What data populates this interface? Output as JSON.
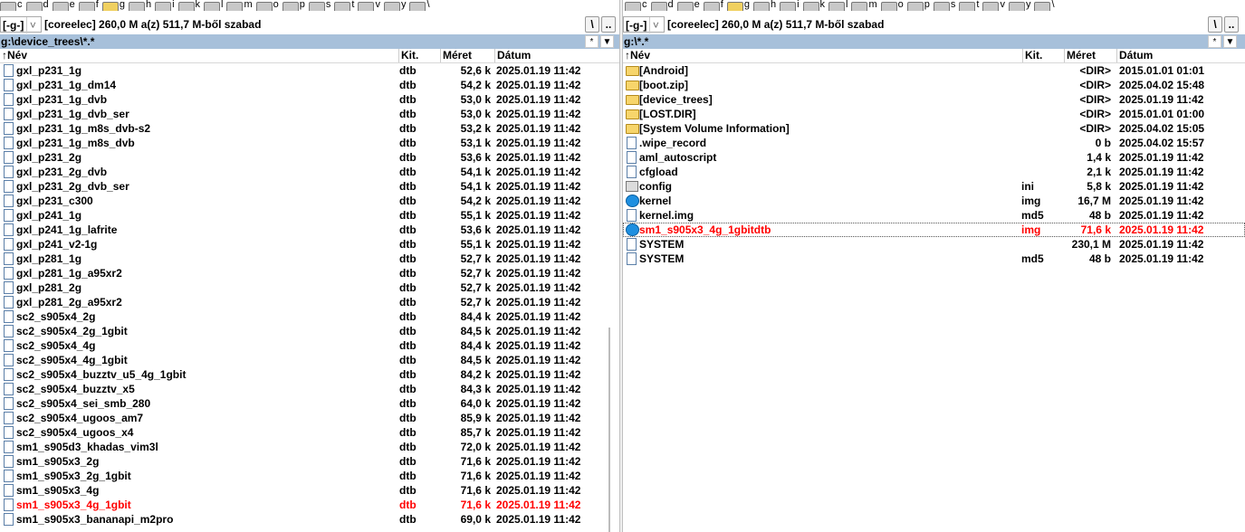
{
  "drives_left": [
    {
      "letter": "c"
    },
    {
      "letter": "d"
    },
    {
      "letter": "e"
    },
    {
      "letter": "f"
    },
    {
      "letter": "g",
      "active": true
    },
    {
      "letter": "h"
    },
    {
      "letter": "i"
    },
    {
      "letter": "k"
    },
    {
      "letter": "l"
    },
    {
      "letter": "m"
    },
    {
      "letter": "o"
    },
    {
      "letter": "p"
    },
    {
      "letter": "s"
    },
    {
      "letter": "t"
    },
    {
      "letter": "v"
    },
    {
      "letter": "y"
    },
    {
      "letter": "\\"
    }
  ],
  "drives_right": [
    {
      "letter": "c"
    },
    {
      "letter": "d"
    },
    {
      "letter": "e"
    },
    {
      "letter": "f"
    },
    {
      "letter": "g",
      "active": true
    },
    {
      "letter": "h"
    },
    {
      "letter": "i"
    },
    {
      "letter": "k"
    },
    {
      "letter": "l"
    },
    {
      "letter": "m"
    },
    {
      "letter": "o"
    },
    {
      "letter": "p"
    },
    {
      "letter": "s"
    },
    {
      "letter": "t"
    },
    {
      "letter": "v"
    },
    {
      "letter": "y"
    },
    {
      "letter": "\\"
    }
  ],
  "left": {
    "drive_combo": "[-g-]",
    "space_info": "[coreelec]  260,0 M a(z) 511,7 M-ből szabad",
    "btn_root": "\\",
    "btn_up": "..",
    "path": "g:\\device_trees\\*.*",
    "filter_btn": "*",
    "history_btn": "▼",
    "headers": {
      "name": "↑Név",
      "ext": "Kit.",
      "size": "Méret",
      "date": "Dátum"
    },
    "files": [
      {
        "name": "gxl_p231_1g",
        "ext": "dtb",
        "size": "52,6 k",
        "date": "2025.01.19 11:42"
      },
      {
        "name": "gxl_p231_1g_dm14",
        "ext": "dtb",
        "size": "54,2 k",
        "date": "2025.01.19 11:42"
      },
      {
        "name": "gxl_p231_1g_dvb",
        "ext": "dtb",
        "size": "53,0 k",
        "date": "2025.01.19 11:42"
      },
      {
        "name": "gxl_p231_1g_dvb_ser",
        "ext": "dtb",
        "size": "53,0 k",
        "date": "2025.01.19 11:42"
      },
      {
        "name": "gxl_p231_1g_m8s_dvb-s2",
        "ext": "dtb",
        "size": "53,2 k",
        "date": "2025.01.19 11:42"
      },
      {
        "name": "gxl_p231_1g_m8s_dvb",
        "ext": "dtb",
        "size": "53,1 k",
        "date": "2025.01.19 11:42"
      },
      {
        "name": "gxl_p231_2g",
        "ext": "dtb",
        "size": "53,6 k",
        "date": "2025.01.19 11:42"
      },
      {
        "name": "gxl_p231_2g_dvb",
        "ext": "dtb",
        "size": "54,1 k",
        "date": "2025.01.19 11:42"
      },
      {
        "name": "gxl_p231_2g_dvb_ser",
        "ext": "dtb",
        "size": "54,1 k",
        "date": "2025.01.19 11:42"
      },
      {
        "name": "gxl_p231_c300",
        "ext": "dtb",
        "size": "54,2 k",
        "date": "2025.01.19 11:42"
      },
      {
        "name": "gxl_p241_1g",
        "ext": "dtb",
        "size": "55,1 k",
        "date": "2025.01.19 11:42"
      },
      {
        "name": "gxl_p241_1g_lafrite",
        "ext": "dtb",
        "size": "53,6 k",
        "date": "2025.01.19 11:42"
      },
      {
        "name": "gxl_p241_v2-1g",
        "ext": "dtb",
        "size": "55,1 k",
        "date": "2025.01.19 11:42"
      },
      {
        "name": "gxl_p281_1g",
        "ext": "dtb",
        "size": "52,7 k",
        "date": "2025.01.19 11:42"
      },
      {
        "name": "gxl_p281_1g_a95xr2",
        "ext": "dtb",
        "size": "52,7 k",
        "date": "2025.01.19 11:42"
      },
      {
        "name": "gxl_p281_2g",
        "ext": "dtb",
        "size": "52,7 k",
        "date": "2025.01.19 11:42"
      },
      {
        "name": "gxl_p281_2g_a95xr2",
        "ext": "dtb",
        "size": "52,7 k",
        "date": "2025.01.19 11:42"
      },
      {
        "name": "sc2_s905x4_2g",
        "ext": "dtb",
        "size": "84,4 k",
        "date": "2025.01.19 11:42"
      },
      {
        "name": "sc2_s905x4_2g_1gbit",
        "ext": "dtb",
        "size": "84,5 k",
        "date": "2025.01.19 11:42"
      },
      {
        "name": "sc2_s905x4_4g",
        "ext": "dtb",
        "size": "84,4 k",
        "date": "2025.01.19 11:42"
      },
      {
        "name": "sc2_s905x4_4g_1gbit",
        "ext": "dtb",
        "size": "84,5 k",
        "date": "2025.01.19 11:42"
      },
      {
        "name": "sc2_s905x4_buzztv_u5_4g_1gbit",
        "ext": "dtb",
        "size": "84,2 k",
        "date": "2025.01.19 11:42"
      },
      {
        "name": "sc2_s905x4_buzztv_x5",
        "ext": "dtb",
        "size": "84,3 k",
        "date": "2025.01.19 11:42"
      },
      {
        "name": "sc2_s905x4_sei_smb_280",
        "ext": "dtb",
        "size": "64,0 k",
        "date": "2025.01.19 11:42"
      },
      {
        "name": "sc2_s905x4_ugoos_am7",
        "ext": "dtb",
        "size": "85,9 k",
        "date": "2025.01.19 11:42"
      },
      {
        "name": "sc2_s905x4_ugoos_x4",
        "ext": "dtb",
        "size": "85,7 k",
        "date": "2025.01.19 11:42"
      },
      {
        "name": "sm1_s905d3_khadas_vim3l",
        "ext": "dtb",
        "size": "72,0 k",
        "date": "2025.01.19 11:42"
      },
      {
        "name": "sm1_s905x3_2g",
        "ext": "dtb",
        "size": "71,6 k",
        "date": "2025.01.19 11:42"
      },
      {
        "name": "sm1_s905x3_2g_1gbit",
        "ext": "dtb",
        "size": "71,6 k",
        "date": "2025.01.19 11:42"
      },
      {
        "name": "sm1_s905x3_4g",
        "ext": "dtb",
        "size": "71,6 k",
        "date": "2025.01.19 11:42"
      },
      {
        "name": "sm1_s905x3_4g_1gbit",
        "ext": "dtb",
        "size": "71,6 k",
        "date": "2025.01.19 11:42",
        "highlight": true
      },
      {
        "name": "sm1_s905x3_bananapi_m2pro",
        "ext": "dtb",
        "size": "69,0 k",
        "date": "2025.01.19 11:42"
      }
    ]
  },
  "right": {
    "drive_combo": "[-g-]",
    "space_info": "[coreelec]  260,0 M a(z) 511,7 M-ből szabad",
    "btn_root": "\\",
    "btn_up": "..",
    "path": "g:\\*.*",
    "filter_btn": "*",
    "history_btn": "▼",
    "headers": {
      "name": "↑Név",
      "ext": "Kit.",
      "size": "Méret",
      "date": "Dátum"
    },
    "files": [
      {
        "name": "[Android]",
        "ext": "",
        "size": "<DIR>",
        "date": "2015.01.01 01:01",
        "icon": "folder"
      },
      {
        "name": "[boot.zip]",
        "ext": "",
        "size": "<DIR>",
        "date": "2025.04.02 15:48",
        "icon": "folder"
      },
      {
        "name": "[device_trees]",
        "ext": "",
        "size": "<DIR>",
        "date": "2025.01.19 11:42",
        "icon": "folder"
      },
      {
        "name": "[LOST.DIR]",
        "ext": "",
        "size": "<DIR>",
        "date": "2015.01.01 01:00",
        "icon": "folder"
      },
      {
        "name": "[System Volume Information]",
        "ext": "",
        "size": "<DIR>",
        "date": "2025.04.02 15:05",
        "icon": "folder"
      },
      {
        "name": ".wipe_record",
        "ext": "",
        "size": "0 b",
        "date": "2025.04.02 15:57",
        "icon": "file"
      },
      {
        "name": "aml_autoscript",
        "ext": "",
        "size": "1,4 k",
        "date": "2025.01.19 11:42",
        "icon": "file"
      },
      {
        "name": "cfgload",
        "ext": "",
        "size": "2,1 k",
        "date": "2025.01.19 11:42",
        "icon": "file"
      },
      {
        "name": "config",
        "ext": "ini",
        "size": "5,8 k",
        "date": "2025.01.19 11:42",
        "icon": "ini"
      },
      {
        "name": "kernel",
        "ext": "img",
        "size": "16,7 M",
        "date": "2025.01.19 11:42",
        "icon": "app"
      },
      {
        "name": "kernel.img",
        "ext": "md5",
        "size": "48 b",
        "date": "2025.01.19 11:42",
        "icon": "file"
      },
      {
        "name": "sm1_s905x3_4g_1gbitdtb",
        "ext": "img",
        "size": "71,6 k",
        "date": "2025.01.19 11:42",
        "icon": "app",
        "highlight": true,
        "cursor": true
      },
      {
        "name": "SYSTEM",
        "ext": "",
        "size": "230,1 M",
        "date": "2025.01.19 11:42",
        "icon": "file"
      },
      {
        "name": "SYSTEM",
        "ext": "md5",
        "size": "48 b",
        "date": "2025.01.19 11:42",
        "icon": "file"
      }
    ]
  }
}
